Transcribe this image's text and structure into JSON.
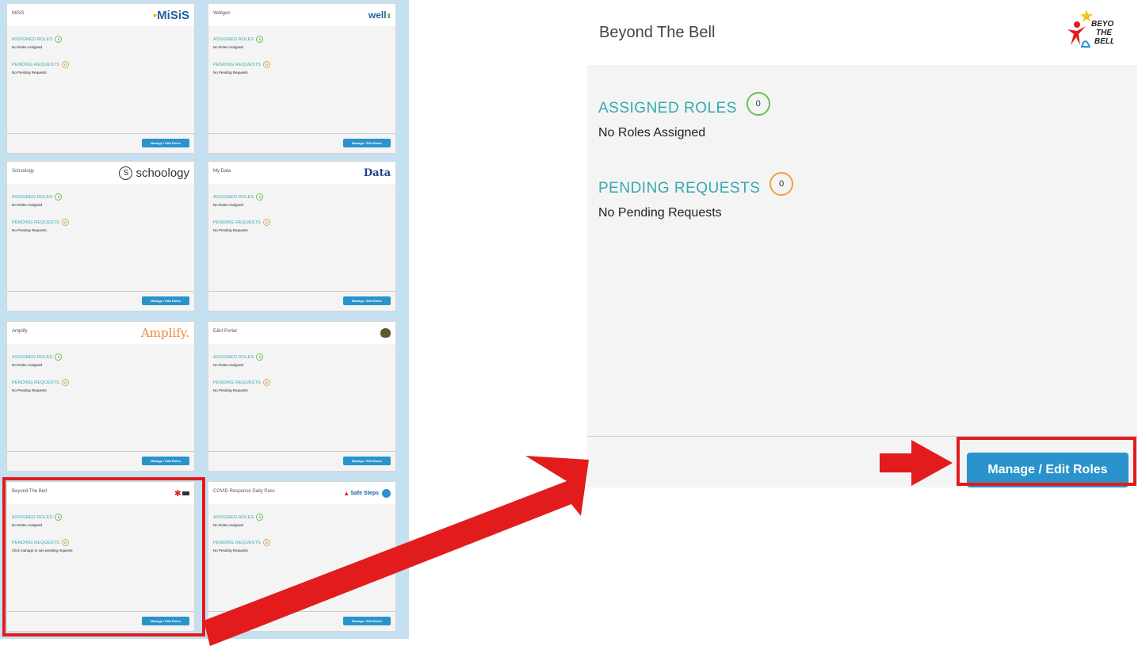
{
  "tiles": [
    {
      "title": "MiSiS",
      "logo_text": "MiSiS",
      "assigned": "ASSIGNED ROLES",
      "assigned_count": "0",
      "assigned_text": "No Roles Assigned",
      "pending": "PENDING REQUESTS",
      "pending_count": "0",
      "pending_text": "No Pending Requests",
      "button": "Manage / Edit Roles"
    },
    {
      "title": "Wellgen",
      "logo_text": "well",
      "assigned": "ASSIGNED ROLES",
      "assigned_count": "0",
      "assigned_text": "No Roles Assigned",
      "pending": "PENDING REQUESTS",
      "pending_count": "0",
      "pending_text": "No Pending Requests",
      "button": "Manage / Edit Roles"
    },
    {
      "title": "Schoology",
      "logo_text": "schoology",
      "assigned": "ASSIGNED ROLES",
      "assigned_count": "0",
      "assigned_text": "No Roles Assigned",
      "pending": "PENDING REQUESTS",
      "pending_count": "0",
      "pending_text": "No Pending Requests",
      "button": "Manage / Edit Roles"
    },
    {
      "title": "My Data",
      "logo_text": "Data",
      "assigned": "ASSIGNED ROLES",
      "assigned_count": "0",
      "assigned_text": "No Roles Assigned",
      "pending": "PENDING REQUESTS",
      "pending_count": "0",
      "pending_text": "No Pending Requests",
      "button": "Manage / Edit Roles"
    },
    {
      "title": "Amplify",
      "logo_text": "Amplify.",
      "assigned": "ASSIGNED ROLES",
      "assigned_count": "0",
      "assigned_text": "No Roles Assigned",
      "pending": "PENDING REQUESTS",
      "pending_count": "0",
      "pending_text": "No Pending Requests",
      "button": "Manage / Edit Roles"
    },
    {
      "title": "E&H Portal",
      "logo_text": "",
      "assigned": "ASSIGNED ROLES",
      "assigned_count": "0",
      "assigned_text": "No Roles Assigned",
      "pending": "PENDING REQUESTS",
      "pending_count": "0",
      "pending_text": "No Pending Requests",
      "button": "Manage / Edit Roles"
    },
    {
      "title": "Beyond The Bell",
      "logo_text": "",
      "assigned": "ASSIGNED ROLES",
      "assigned_count": "0",
      "assigned_text": "No Roles Assigned",
      "pending": "PENDING REQUESTS",
      "pending_count": "0",
      "pending_text": "Click manage to see pending requests",
      "button": "Manage / Edit Roles"
    },
    {
      "title": "COVID Response Daily Pass",
      "logo_text": "Safe Steps",
      "assigned": "ASSIGNED ROLES",
      "assigned_count": "0",
      "assigned_text": "No Roles Assigned",
      "pending": "PENDING REQUESTS",
      "pending_count": "0",
      "pending_text": "No Pending Requests",
      "button": "Manage / Edit Roles"
    }
  ],
  "detail": {
    "title": "Beyond The Bell",
    "logo_lines": [
      "BEYOND",
      "THE",
      "BELL"
    ],
    "assigned_label": "ASSIGNED ROLES",
    "assigned_count": "0",
    "assigned_text": "No Roles Assigned",
    "pending_label": "PENDING REQUESTS",
    "pending_count": "0",
    "pending_text": "No Pending Requests",
    "button_label": "Manage / Edit Roles"
  },
  "colors": {
    "accent_teal": "#35a9b0",
    "button_blue": "#2a93cc",
    "highlight_red": "#e21c1c",
    "assigned_ring": "#6cbf57",
    "pending_ring": "#f0a040",
    "grid_bg": "#c5e0f0"
  }
}
